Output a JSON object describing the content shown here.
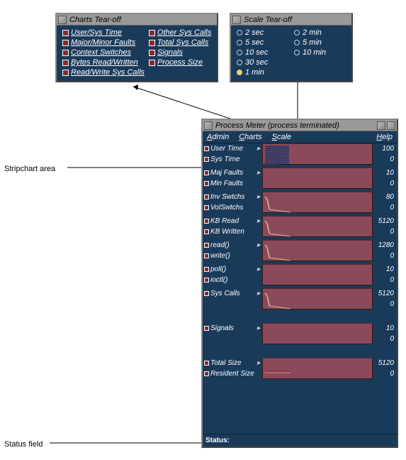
{
  "callouts": {
    "stripchart": "Stripchart area",
    "status": "Status field"
  },
  "charts_tearoff": {
    "title": "Charts Tear-off",
    "items_col1": [
      "User/Sys Time",
      "Major/Minor Faults",
      "Context Switches",
      "Bytes Read/Written",
      "Read/Write Sys Calls"
    ],
    "items_col2": [
      "Other Sys Calls",
      "Total Sys Calls",
      "Signals",
      "Process Size"
    ]
  },
  "scale_tearoff": {
    "title": "Scale Tear-off",
    "options_col1": [
      "2 sec",
      "5 sec",
      "10 sec",
      "30 sec",
      "1 min"
    ],
    "options_col2": [
      "2 min",
      "5 min",
      "10 min"
    ],
    "selected": "1 min"
  },
  "process_meter": {
    "title": "Process Meter (process terminated)",
    "menus": {
      "admin": "Admin",
      "charts": "Charts",
      "scale": "Scale",
      "help": "Help"
    },
    "status_label": "Status:",
    "pairs": [
      {
        "a": "User Time",
        "b": "Sys Time",
        "hi": "100",
        "lo": "0",
        "fill": true
      },
      {
        "a": "Maj Faults",
        "b": "Min Faults",
        "hi": "10",
        "lo": "0",
        "line": false
      },
      {
        "a": "Inv Swtchs",
        "b": "VolSwtchs",
        "hi": "80",
        "lo": "0",
        "line": true
      },
      {
        "a": "KB Read",
        "b": "KB Written",
        "hi": "5120",
        "lo": "0",
        "line": true
      },
      {
        "a": "read()",
        "b": "write()",
        "hi": "1280",
        "lo": "0",
        "line": true
      },
      {
        "a": "poll()",
        "b": "ioctl()",
        "hi": "10",
        "lo": "0",
        "line": false
      },
      {
        "a": "Sys Calls",
        "b": "",
        "hi": "5120",
        "lo": "0",
        "line": true,
        "single": true
      },
      {
        "a": "Signals",
        "b": "",
        "hi": "10",
        "lo": "0",
        "line": false,
        "single": true
      },
      {
        "a": "Total Size",
        "b": "Resident Size",
        "hi": "5120",
        "lo": "0",
        "flat": true
      }
    ]
  },
  "chart_data": [
    {
      "type": "line",
      "title": "User/Sys Time",
      "ylabel": "",
      "ylim": [
        0,
        100
      ],
      "series": [
        {
          "name": "User Time",
          "values": [
            70,
            72,
            68,
            40,
            0
          ]
        },
        {
          "name": "Sys Time",
          "values": [
            30,
            28,
            32,
            20,
            0
          ]
        }
      ]
    },
    {
      "type": "line",
      "title": "Maj/Min Faults",
      "ylabel": "",
      "ylim": [
        0,
        10
      ],
      "series": [
        {
          "name": "Maj Faults",
          "values": [
            0,
            0,
            0,
            0,
            0
          ]
        },
        {
          "name": "Min Faults",
          "values": [
            0,
            0,
            0,
            0,
            0
          ]
        }
      ]
    },
    {
      "type": "line",
      "title": "Context Switches",
      "ylabel": "",
      "ylim": [
        0,
        80
      ],
      "series": [
        {
          "name": "Inv Swtchs",
          "values": [
            60,
            20,
            8,
            4,
            0
          ]
        },
        {
          "name": "VolSwtchs",
          "values": [
            10,
            5,
            3,
            2,
            0
          ]
        }
      ]
    },
    {
      "type": "line",
      "title": "KB Read/Written",
      "ylabel": "",
      "ylim": [
        0,
        5120
      ],
      "series": [
        {
          "name": "KB Read",
          "values": [
            4000,
            1200,
            600,
            200,
            0
          ]
        },
        {
          "name": "KB Written",
          "values": [
            500,
            300,
            150,
            50,
            0
          ]
        }
      ]
    },
    {
      "type": "line",
      "title": "read()/write()",
      "ylabel": "",
      "ylim": [
        0,
        1280
      ],
      "series": [
        {
          "name": "read()",
          "values": [
            1000,
            400,
            150,
            50,
            0
          ]
        },
        {
          "name": "write()",
          "values": [
            200,
            100,
            40,
            10,
            0
          ]
        }
      ]
    },
    {
      "type": "line",
      "title": "poll()/ioctl()",
      "ylabel": "",
      "ylim": [
        0,
        10
      ],
      "series": [
        {
          "name": "poll()",
          "values": [
            0,
            0,
            0,
            0,
            0
          ]
        },
        {
          "name": "ioctl()",
          "values": [
            0,
            0,
            0,
            0,
            0
          ]
        }
      ]
    },
    {
      "type": "line",
      "title": "Sys Calls",
      "ylabel": "",
      "ylim": [
        0,
        5120
      ],
      "series": [
        {
          "name": "Sys Calls",
          "values": [
            4500,
            1800,
            700,
            200,
            0
          ]
        }
      ]
    },
    {
      "type": "line",
      "title": "Signals",
      "ylabel": "",
      "ylim": [
        0,
        10
      ],
      "series": [
        {
          "name": "Signals",
          "values": [
            0,
            0,
            0,
            0,
            0
          ]
        }
      ]
    },
    {
      "type": "line",
      "title": "Process Size",
      "ylabel": "",
      "ylim": [
        0,
        5120
      ],
      "series": [
        {
          "name": "Total Size",
          "values": [
            1800,
            1800,
            1800,
            1800,
            1800
          ]
        },
        {
          "name": "Resident Size",
          "values": [
            1500,
            1500,
            1500,
            1500,
            1500
          ]
        }
      ]
    }
  ]
}
